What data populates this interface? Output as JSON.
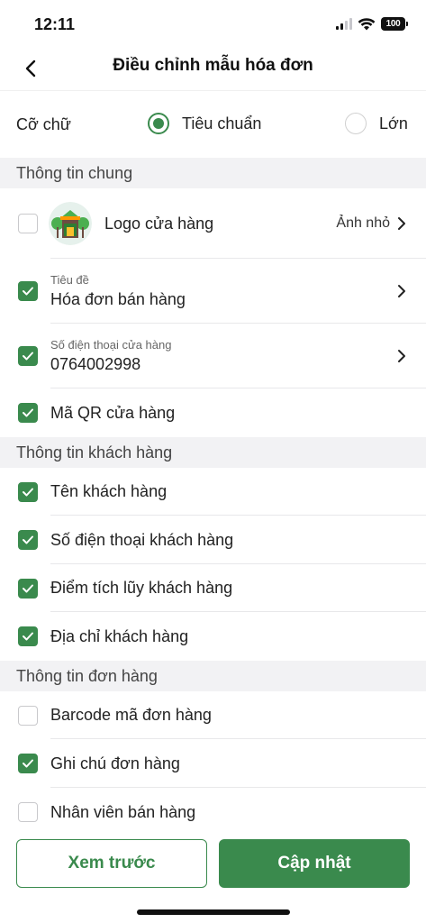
{
  "status_bar": {
    "time": "12:11",
    "battery": "100"
  },
  "nav": {
    "title": "Điều chỉnh mẫu hóa đơn"
  },
  "font_size": {
    "label": "Cỡ chữ",
    "options": [
      {
        "label": "Tiêu chuẩn",
        "selected": true
      },
      {
        "label": "Lớn",
        "selected": false
      }
    ]
  },
  "sections": {
    "general": {
      "title": "Thông tin chung",
      "logo": {
        "label": "Logo cửa hàng",
        "value": "Ảnh nhỏ",
        "checked": false
      },
      "title_row": {
        "sublabel": "Tiêu đề",
        "value": "Hóa đơn bán hàng",
        "checked": true
      },
      "phone_row": {
        "sublabel": "Số điện thoại cửa hàng",
        "value": "0764002998",
        "checked": true
      },
      "qr_row": {
        "label": "Mã QR cửa hàng",
        "checked": true
      }
    },
    "customer": {
      "title": "Thông tin khách hàng",
      "items": [
        {
          "label": "Tên khách hàng",
          "checked": true
        },
        {
          "label": "Số điện thoại khách hàng",
          "checked": true
        },
        {
          "label": "Điểm tích lũy khách hàng",
          "checked": true
        },
        {
          "label": "Địa chỉ khách hàng",
          "checked": true
        }
      ]
    },
    "order": {
      "title": "Thông tin đơn hàng",
      "items": [
        {
          "label": "Barcode mã đơn hàng",
          "checked": false
        },
        {
          "label": "Ghi chú đơn hàng",
          "checked": true
        },
        {
          "label": "Nhân viên bán hàng",
          "checked": false
        }
      ]
    }
  },
  "buttons": {
    "preview": "Xem trước",
    "update": "Cập nhật"
  },
  "colors": {
    "accent": "#3a8a4d",
    "section_bg": "#f2f2f4"
  }
}
